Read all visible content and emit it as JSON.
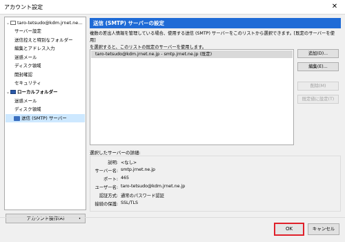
{
  "window": {
    "title": "アカウント設定",
    "close_glyph": "✕"
  },
  "tree": {
    "account": "taro-tetsudo@kdm.jrnet.ne...",
    "account_children": [
      "サーバー設定",
      "送信控えと特別なフォルダー",
      "編集とアドレス入力",
      "迷惑メール",
      "ディスク領域",
      "開封確認",
      "セキュリティ"
    ],
    "local": "ローカルフォルダー",
    "local_children": [
      "迷惑メール",
      "ディスク領域"
    ],
    "smtp": "送信 (SMTP) サーバー"
  },
  "account_actions": {
    "label": "アカウント操作(A)",
    "arrow": "▾"
  },
  "panel": {
    "title": "送信 (SMTP) サーバーの設定",
    "description_line1": "複数の差出人情報を管理している場合、使用する送信 (SMTP) サーバーをこのリストから選択できます。[既定のサーバーを使用]",
    "description_line2": "を選択すると、このリストの既定のサーバーを使用します。"
  },
  "servers": [
    {
      "label": "taro-tetsudo@kdm.jrnet.ne.jp - smtp.jrnet.ne.jp (既定)"
    }
  ],
  "buttons": {
    "add": "追加(D)...",
    "edit": "編集(E)...",
    "remove": "削除(M)",
    "set_default": "既定値に設定(T)"
  },
  "details": {
    "title": "選択したサーバーの詳細:",
    "rows": [
      {
        "label": "説明:",
        "value": "<なし>"
      },
      {
        "label": "サーバー名:",
        "value": "smtp.jrnet.ne.jp"
      },
      {
        "label": "ポート:",
        "value": "465"
      },
      {
        "label": "ユーザー名:",
        "value": "taro-tetsudo@kdm.jrnet.ne.jp"
      },
      {
        "label": "認証方式:",
        "value": "通常のパスワード認証"
      },
      {
        "label": "接続の保護:",
        "value": "SSL/TLS"
      }
    ]
  },
  "footer": {
    "ok": "OK",
    "cancel": "キャンセル"
  }
}
